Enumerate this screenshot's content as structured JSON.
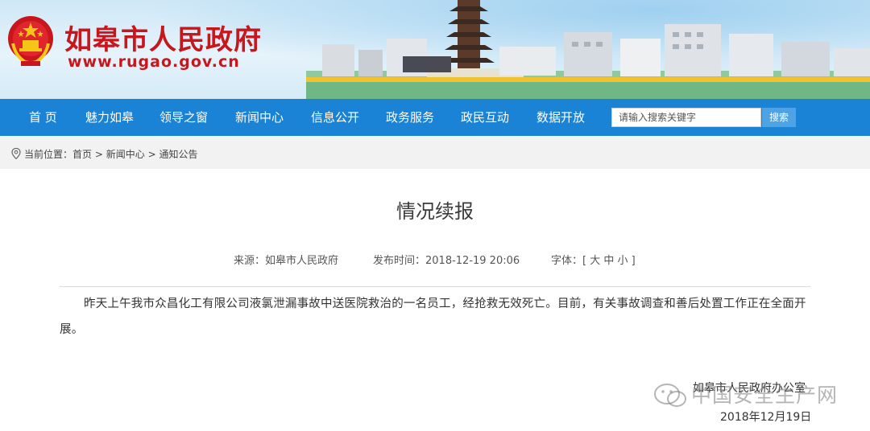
{
  "header": {
    "site_title": "如皋市人民政府",
    "site_url": "www.rugao.gov.cn"
  },
  "nav": {
    "items": [
      {
        "label": "首  页"
      },
      {
        "label": "魅力如皋"
      },
      {
        "label": "领导之窗"
      },
      {
        "label": "新闻中心"
      },
      {
        "label": "信息公开"
      },
      {
        "label": "政务服务"
      },
      {
        "label": "政民互动"
      },
      {
        "label": "数据开放"
      }
    ],
    "search_placeholder": "请输入搜索关键字",
    "search_button": "搜索"
  },
  "breadcrumb": {
    "prefix": "当前位置：",
    "items": [
      "首页",
      "新闻中心",
      "通知公告"
    ],
    "separator": ">"
  },
  "article": {
    "title": "情况续报",
    "source": "来源：如皋市人民政府",
    "publish_time": "发布时间：2018-12-19 20:06",
    "font_size": "字体：[ 大 中 小 ]",
    "body": "昨天上午我市众昌化工有限公司液氯泄漏事故中送医院救治的一名员工，经抢救无效死亡。目前，有关事故调查和善后处置工作正在全面开展。",
    "signoff": "如皋市人民政府办公室",
    "date": "2018年12月19日"
  },
  "watermark": {
    "text": "中国安全生产网"
  },
  "colors": {
    "brand_red": "#c8161d",
    "nav_blue": "#1a83d6"
  }
}
